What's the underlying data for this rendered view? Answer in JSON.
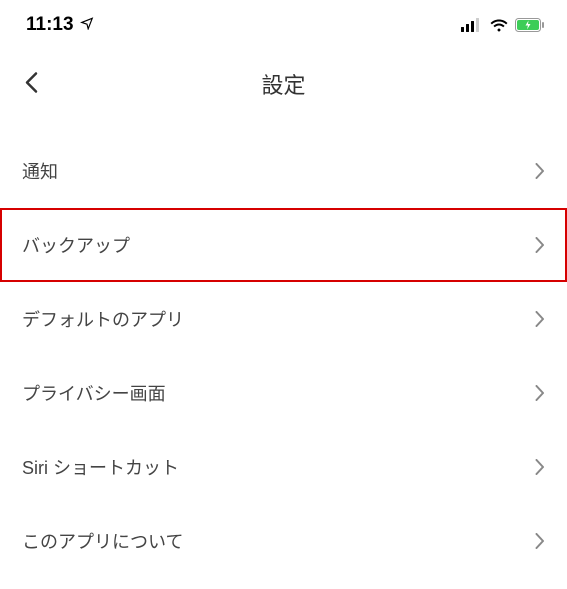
{
  "status_bar": {
    "time": "11:13"
  },
  "header": {
    "title": "設定"
  },
  "menu": {
    "items": [
      {
        "label": "通知",
        "highlighted": false
      },
      {
        "label": "バックアップ",
        "highlighted": true
      },
      {
        "label": "デフォルトのアプリ",
        "highlighted": false
      },
      {
        "label": "プライバシー画面",
        "highlighted": false
      },
      {
        "label": "Siri ショートカット",
        "highlighted": false
      },
      {
        "label": "このアプリについて",
        "highlighted": false
      }
    ]
  }
}
